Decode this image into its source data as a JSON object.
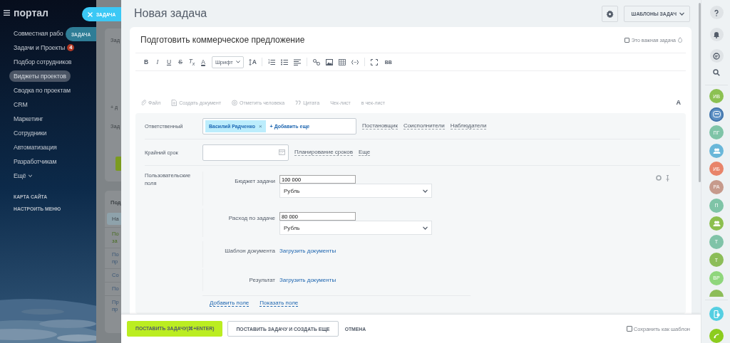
{
  "sidebar": {
    "logo": "портал",
    "menu": [
      {
        "label": "Совместная рабо",
        "selected": false,
        "dropdown": false
      },
      {
        "label": "Задачи и Проекты",
        "badge": "4",
        "selected": false,
        "dropdown": false
      },
      {
        "label": "Подбор сотрудников",
        "selected": false,
        "dropdown": false
      },
      {
        "label": "Виджеты проектов",
        "selected": true,
        "dropdown": false
      },
      {
        "label": "Сводка по проектам",
        "selected": false,
        "dropdown": false
      },
      {
        "label": "CRM",
        "selected": false,
        "dropdown": false
      },
      {
        "label": "Маркетинг",
        "selected": false,
        "dropdown": false
      },
      {
        "label": "Сотрудники",
        "selected": false,
        "dropdown": false
      },
      {
        "label": "Автоматизация",
        "selected": false,
        "dropdown": false
      },
      {
        "label": "Разработчикам",
        "selected": false,
        "dropdown": false
      },
      {
        "label": "Ещё",
        "selected": false,
        "dropdown": true
      }
    ],
    "links": [
      "КАРТА САЙТА",
      "НАСТРОИТЬ МЕНЮ"
    ]
  },
  "slider_tabs": [
    {
      "label": "ЗАДАЧА",
      "selected": true
    },
    {
      "label": "ЗАДАЧА",
      "selected": false
    }
  ],
  "background": {
    "card_1": [
      "Зад",
      "+ д",
      "Зад"
    ],
    "card_2_title": "Под",
    "card_2_items": [
      {
        "text": "На",
        "kind": "active"
      },
      {
        "text": "По за",
        "kind": "green"
      },
      {
        "text": "По пр",
        "kind": "link"
      },
      {
        "text": "Со",
        "kind": "link"
      },
      {
        "text": "По",
        "kind": "link"
      },
      {
        "text": "Пр пр",
        "kind": "link"
      }
    ]
  },
  "panel": {
    "title": "Новая задача",
    "templates_button": "ШАБЛОНЫ ЗАДАЧ",
    "task_title": "Подготовить коммерческое предложение",
    "important": {
      "label": "Это важная задача",
      "checked": false
    },
    "format_buttons": [
      {
        "label": "B",
        "kind": "bold"
      },
      {
        "label": "I",
        "kind": "italic"
      },
      {
        "label": "U",
        "kind": "underline"
      },
      {
        "label": "S",
        "kind": "strike"
      },
      {
        "label": "T$_{x}$",
        "kind": "clear"
      },
      {
        "label": "A",
        "kind": "color"
      }
    ],
    "font_select": "Шрифт",
    "size_button": "A",
    "bb_button": "BB",
    "attachments": [
      {
        "label": "Файл",
        "kind": "file"
      },
      {
        "label": "Создать документ",
        "kind": "doc"
      },
      {
        "label": "Отметить человека",
        "kind": "mention"
      },
      {
        "label": "Цитата",
        "kind": "quote"
      },
      {
        "label": "Чек-лист",
        "kind": "plain"
      },
      {
        "label": "в чек-лист",
        "kind": "plain"
      }
    ],
    "style_button": "A",
    "responsible": {
      "label": "Ответственный",
      "person": "Василий Радченко",
      "remove": "×",
      "add": "+ Добавить еще",
      "roles": [
        "Постановщик",
        "Соисполнители",
        "Наблюдатели"
      ]
    },
    "deadline": {
      "label": "Крайний срок",
      "links": [
        "Планирование сроков",
        "Еще"
      ]
    },
    "custom_fields": {
      "label": "Пользовательские поля",
      "fields": [
        {
          "kind": "money",
          "label": "Бюджет задачи",
          "value": "100 000",
          "currency": "Рубль"
        },
        {
          "kind": "money",
          "label": "Расход по задаче",
          "value": "80 000",
          "currency": "Рубль"
        },
        {
          "kind": "file",
          "label": "Шаблон документа",
          "link": "Загрузить документы"
        },
        {
          "kind": "file",
          "label": "Результат",
          "link": "Загрузить документы"
        }
      ],
      "links": [
        "Добавить поле",
        "Показать поле"
      ]
    }
  },
  "footer": {
    "buttons": [
      {
        "label": "ПОСТАВИТЬ ЗАДАЧУ(⌘+ENTER)",
        "kind": "primary"
      },
      {
        "label": "ПОСТАВИТЬ ЗАДАЧУ И СОЗДАТЬ ЕЩЕ",
        "kind": "secondary"
      },
      {
        "label": "ОТМЕНА",
        "kind": "link"
      }
    ],
    "save_template": {
      "label": "Сохранить как шаблон",
      "checked": false
    }
  },
  "rail": {
    "contacts": [
      {
        "kind": "initials",
        "initials": "ИВ",
        "color": "#8cc152"
      },
      {
        "kind": "chat",
        "color": "#5b8fc4"
      },
      {
        "kind": "initials",
        "initials": "ПГ",
        "color": "#7fc4a7"
      },
      {
        "kind": "group",
        "color": "#6ab7d9"
      },
      {
        "kind": "initials",
        "initials": "ИБ",
        "color": "#e8846a"
      },
      {
        "kind": "initials",
        "initials": "РА",
        "color": "#c69a8c"
      },
      {
        "kind": "initials",
        "initials": "П",
        "color": "#7fc4a7"
      },
      {
        "kind": "group",
        "color": "#8cbf4f"
      },
      {
        "kind": "initials",
        "initials": "Т",
        "color": "#80c3a8"
      },
      {
        "kind": "initials",
        "initials": "Т",
        "color": "#8cbd58"
      },
      {
        "kind": "initials",
        "initials": "ВР",
        "color": "#8fd67c"
      },
      {
        "kind": "blank",
        "color": "#8cbd58"
      }
    ]
  }
}
